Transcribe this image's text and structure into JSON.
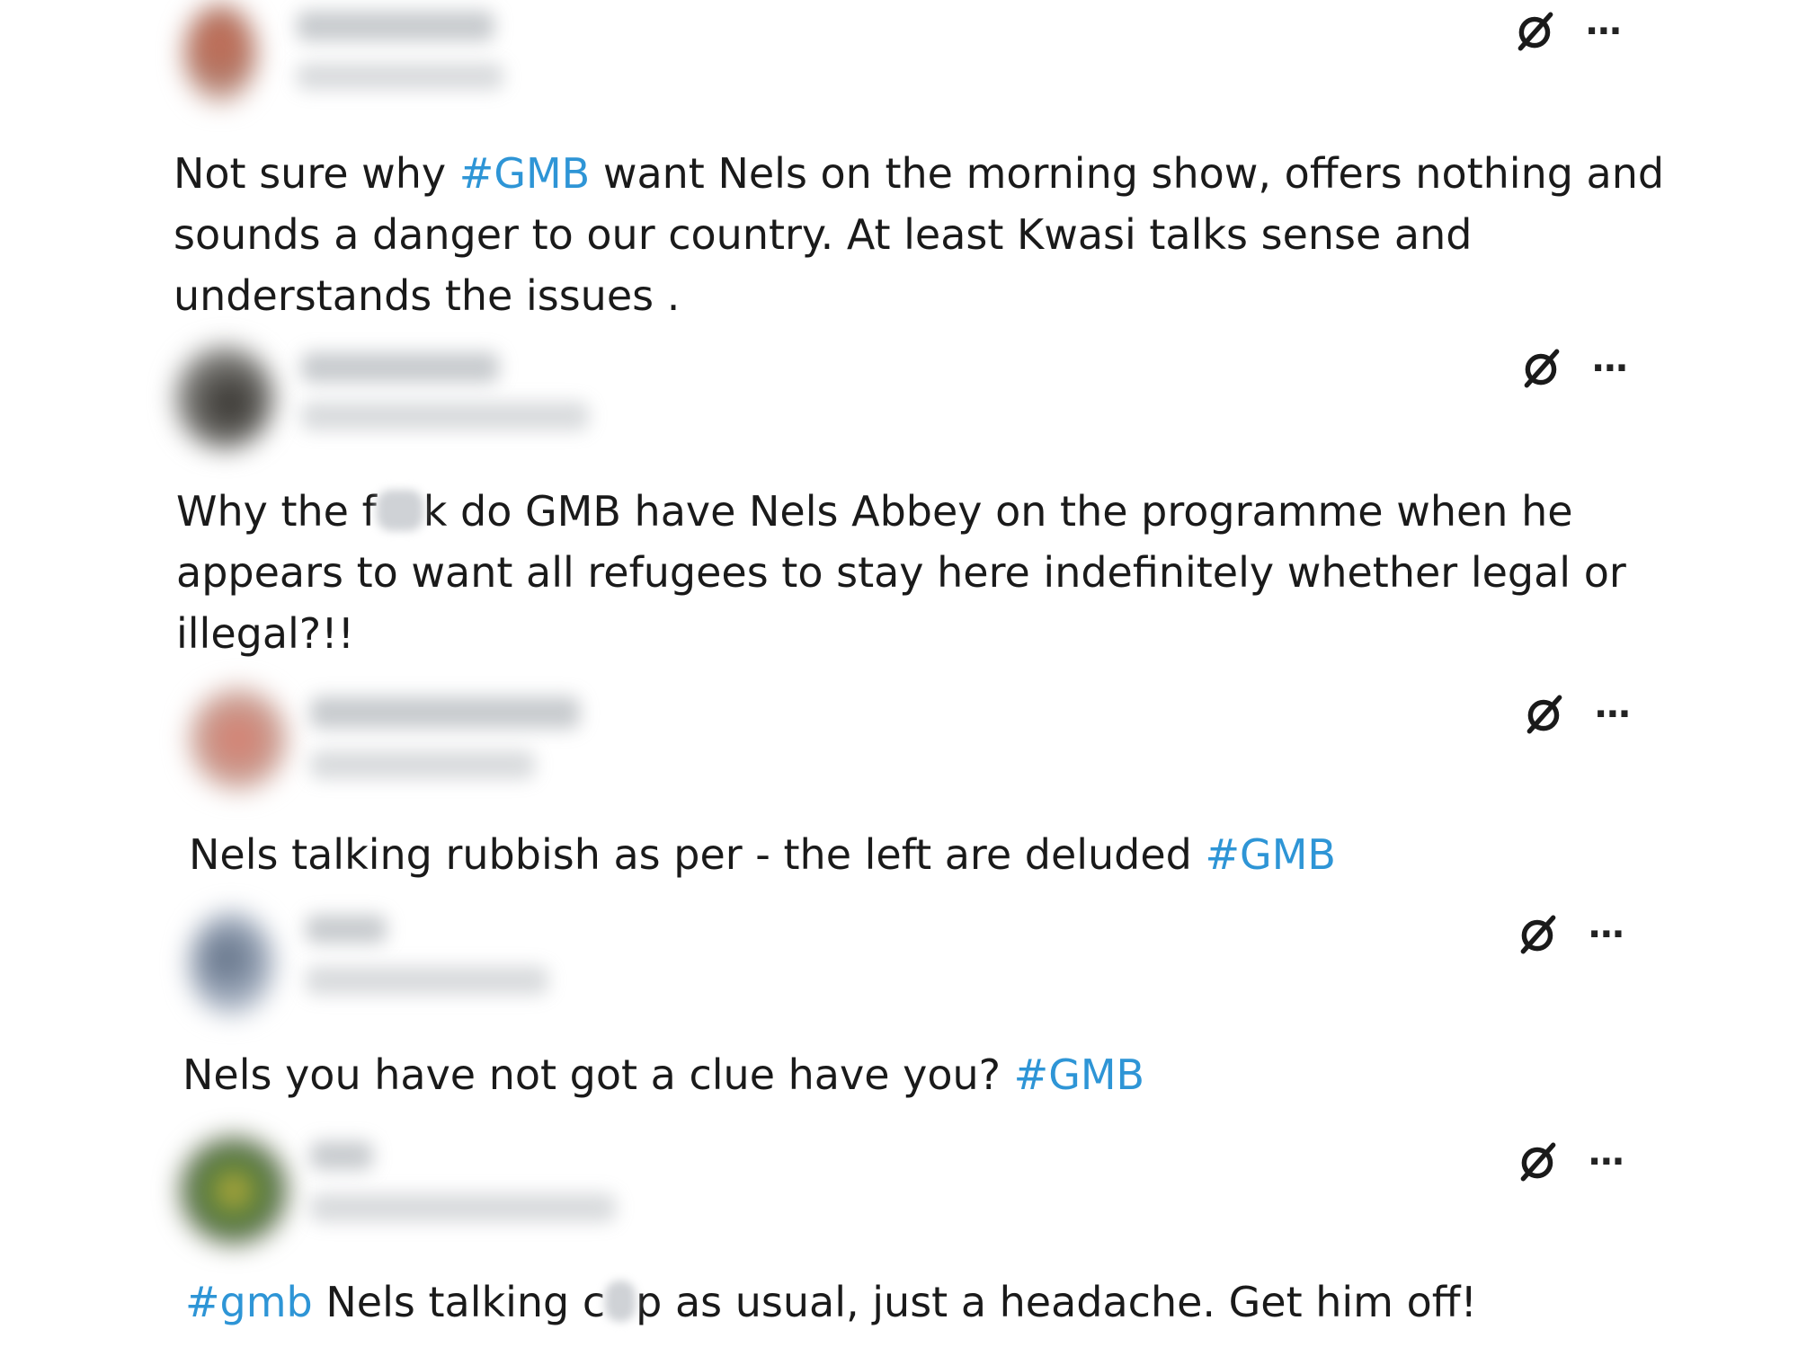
{
  "colors": {
    "hashtag": "#2e95d6",
    "text": "#1a1a1a",
    "background": "#ffffff"
  },
  "icons": {
    "action": "grok-icon",
    "menu": "more-icon"
  },
  "menu_glyph": "···",
  "posts": [
    {
      "seg": [
        "Not sure why ",
        "#GMB",
        " want Nels on the morning show, offers nothing and"
      ],
      "line2": "sounds a danger to our country. At least Kwasi talks sense and",
      "line3": "understands the issues ."
    },
    {
      "a": "Why the f",
      "b": "k do GMB have Nels Abbey on the programme when he",
      "line2": "appears to want all refugees to stay here indefinitely whether legal or",
      "line3": "illegal?!!"
    },
    {
      "seg": [
        "Nels talking rubbish as per  - the left are deluded  ",
        "#GMB"
      ]
    },
    {
      "seg": [
        "Nels you have not got a clue have you? ",
        "#GMB"
      ]
    },
    {
      "tag": "#gmb",
      "a": " Nels talking c",
      "b": "p as usual, just a headache. Get him off!"
    }
  ]
}
